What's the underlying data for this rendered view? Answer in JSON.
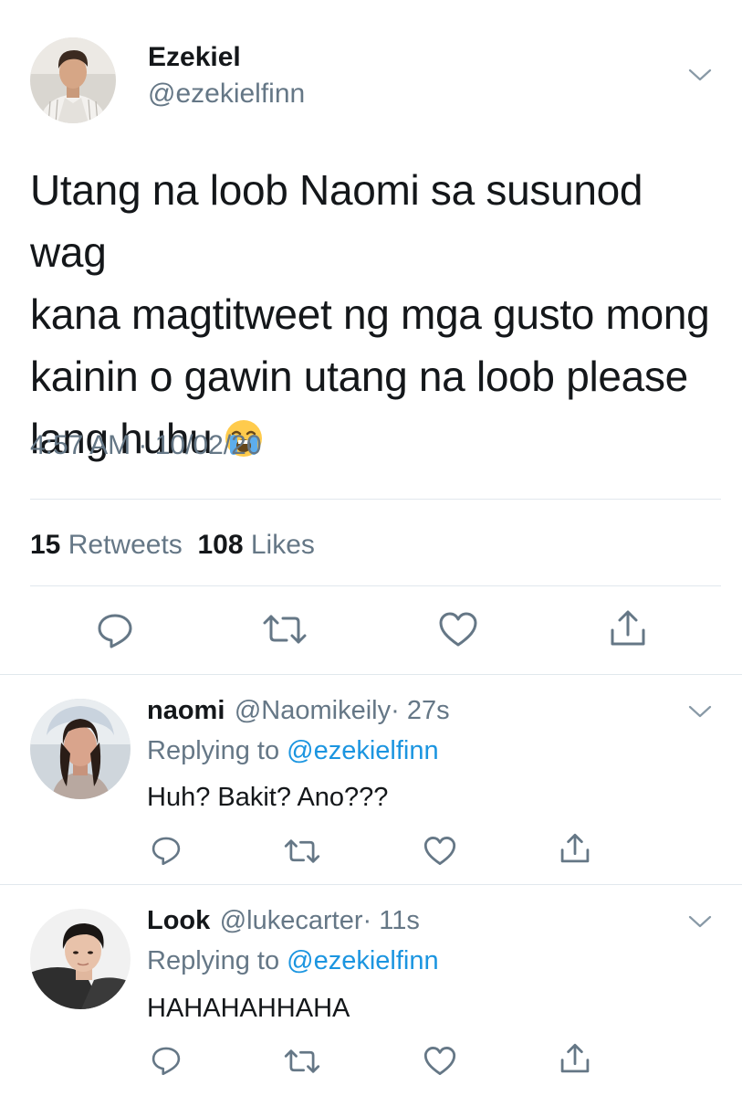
{
  "main_tweet": {
    "author_name": "Ezekiel",
    "author_handle": "@ezekielfinn",
    "text_lines": [
      "Utang na loob Naomi sa susunod wag",
      "kana magtitweet ng mga gusto mong",
      "kainin o gawin utang na loob please",
      "lang huhu"
    ],
    "emoji": "loudly-crying-face",
    "timestamp": "4:57 AM · 10/02/20",
    "retweets_count": "15",
    "retweets_label": "Retweets",
    "likes_count": "108",
    "likes_label": "Likes"
  },
  "replies": [
    {
      "author_name": "naomi",
      "author_handle": "@Naomikeily",
      "time": "· 27s",
      "replying_label": "Replying to",
      "replying_to": "@ezekielfinn",
      "text": "Huh? Bakit? Ano???"
    },
    {
      "author_name": "Look",
      "author_handle": "@lukecarter",
      "time": "· 11s",
      "replying_label": "Replying to",
      "replying_to": "@ezekielfinn",
      "text": "HAHAHAHHAHA"
    }
  ],
  "icons": {
    "reply": "reply-icon",
    "retweet": "retweet-icon",
    "like": "like-icon",
    "share": "share-icon",
    "more": "chevron-down-icon"
  },
  "colors": {
    "text_primary": "#14171a",
    "text_secondary": "#657786",
    "link": "#1b95e0",
    "divider": "#e1e8ed"
  }
}
